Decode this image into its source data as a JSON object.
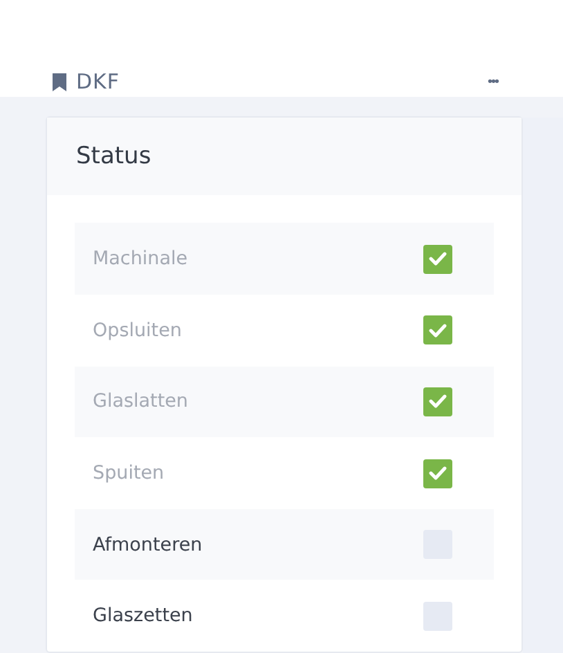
{
  "header": {
    "title": "DKF",
    "menu": "•••"
  },
  "status_card": {
    "title": "Status",
    "items": [
      {
        "label": "Machinale",
        "checked": true
      },
      {
        "label": "Opsluiten",
        "checked": true
      },
      {
        "label": "Glaslatten",
        "checked": true
      },
      {
        "label": "Spuiten",
        "checked": true
      },
      {
        "label": "Afmonteren",
        "checked": false
      },
      {
        "label": "Glaszetten",
        "checked": false
      }
    ]
  }
}
